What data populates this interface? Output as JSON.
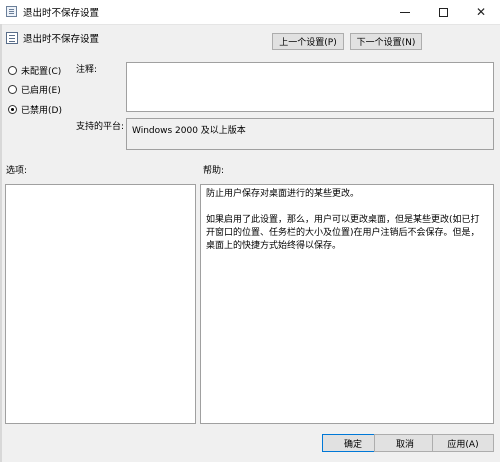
{
  "window": {
    "title": "退出时不保存设置",
    "minimize_glyph": "—",
    "close_glyph": "✕"
  },
  "header": {
    "title": "退出时不保存设置",
    "prev_button": "上一个设置(P)",
    "next_button": "下一个设置(N)"
  },
  "state_options": {
    "items": [
      {
        "label": "未配置(C)",
        "checked": false
      },
      {
        "label": "已启用(E)",
        "checked": false
      },
      {
        "label": "已禁用(D)",
        "checked": true
      }
    ]
  },
  "fields": {
    "note_label": "注释:",
    "note_value": "",
    "platform_label": "支持的平台:",
    "platform_value": "Windows 2000 及以上版本"
  },
  "sections": {
    "options_label": "选项:",
    "help_label": "帮助:"
  },
  "help": {
    "para1": "防止用户保存对桌面进行的某些更改。",
    "para2": "如果启用了此设置，那么，用户可以更改桌面，但是某些更改(如已打开窗口的位置、任务栏的大小及位置)在用户注销后不会保存。但是，桌面上的快捷方式始终得以保存。"
  },
  "footer": {
    "ok": "确定",
    "cancel": "取消",
    "apply": "应用(A)"
  }
}
